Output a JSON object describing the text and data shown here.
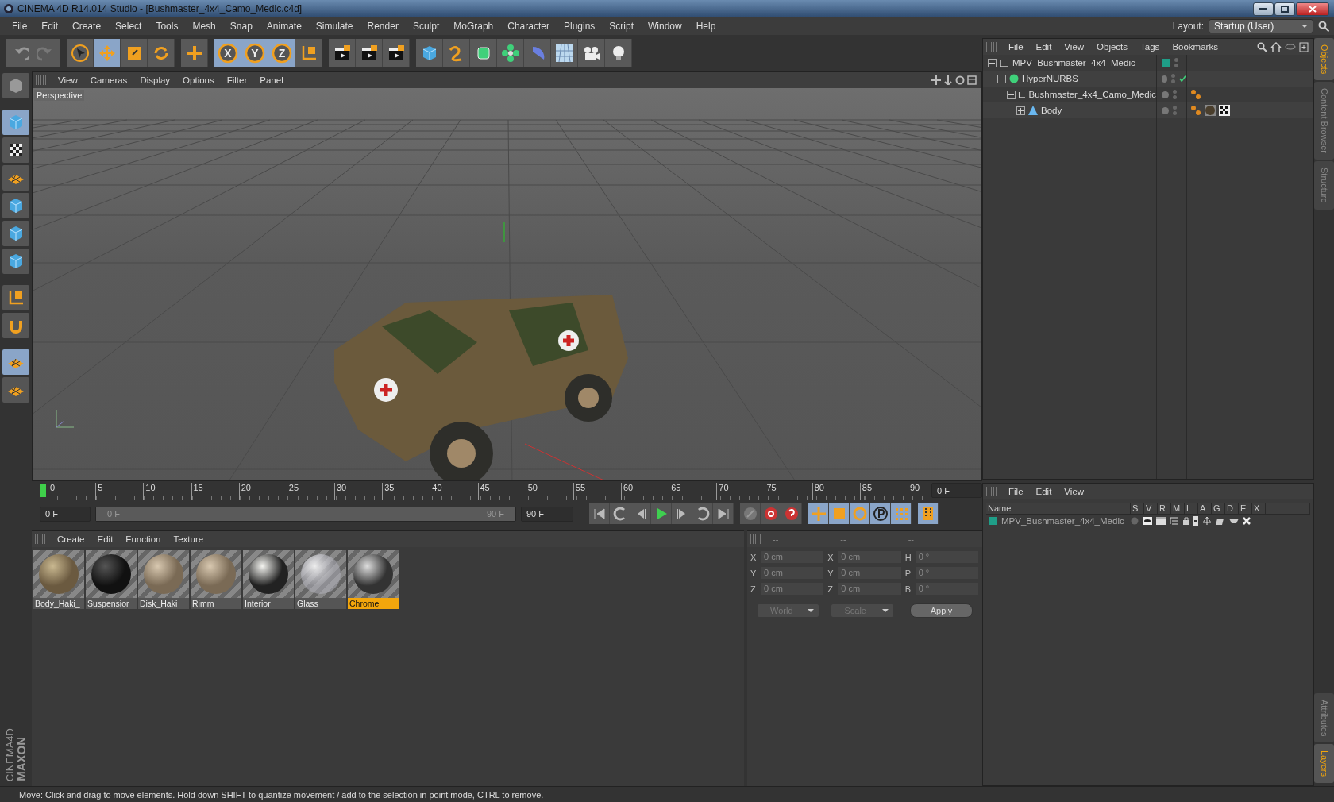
{
  "window": {
    "title": "CINEMA 4D R14.014 Studio - [Bushmaster_4x4_Camo_Medic.c4d]"
  },
  "menu": [
    "File",
    "Edit",
    "Create",
    "Select",
    "Tools",
    "Mesh",
    "Snap",
    "Animate",
    "Simulate",
    "Render",
    "Sculpt",
    "MoGraph",
    "Character",
    "Plugins",
    "Script",
    "Window",
    "Help"
  ],
  "layout": {
    "label": "Layout:",
    "value": "Startup (User)"
  },
  "toolbar": [
    [
      {
        "kind": "undo",
        "selected": false
      },
      {
        "kind": "redo",
        "selected": false
      }
    ],
    [
      {
        "kind": "select",
        "selected": false
      },
      {
        "kind": "move",
        "selected": true
      },
      {
        "kind": "scale",
        "selected": false
      },
      {
        "kind": "rotate",
        "selected": false
      }
    ],
    [
      {
        "kind": "add",
        "selected": false
      }
    ],
    [
      {
        "kind": "axis",
        "label": "X",
        "selected": true
      },
      {
        "kind": "axis",
        "label": "Y",
        "selected": true
      },
      {
        "kind": "axis",
        "label": "Z",
        "selected": true
      },
      {
        "kind": "coord",
        "selected": false
      }
    ],
    [
      {
        "kind": "render",
        "selected": false
      },
      {
        "kind": "render",
        "selected": false
      },
      {
        "kind": "render",
        "selected": false
      }
    ],
    [
      {
        "kind": "cube",
        "selected": false
      },
      {
        "kind": "spline",
        "selected": false
      },
      {
        "kind": "nurbs",
        "selected": false
      },
      {
        "kind": "array",
        "selected": false
      },
      {
        "kind": "deformer",
        "selected": false
      },
      {
        "kind": "floor",
        "selected": false
      },
      {
        "kind": "camera",
        "selected": false
      },
      {
        "kind": "light",
        "selected": false
      }
    ]
  ],
  "left_tools": [
    {
      "kind": "model",
      "selected": false
    },
    {
      "kind": "cube",
      "selected": true
    },
    {
      "kind": "checker",
      "selected": false
    },
    {
      "kind": "grid",
      "selected": false
    },
    {
      "kind": "cube",
      "selected": false
    },
    {
      "kind": "cube",
      "selected": false
    },
    {
      "kind": "cube",
      "selected": false
    },
    {
      "kind": "coord",
      "selected": false
    },
    {
      "kind": "magnet",
      "selected": false
    },
    {
      "kind": "grid",
      "selected": true
    },
    {
      "kind": "grid",
      "selected": false
    }
  ],
  "viewport": {
    "menu": [
      "View",
      "Cameras",
      "Display",
      "Options",
      "Filter",
      "Panel"
    ],
    "label": "Perspective"
  },
  "timeline": {
    "ticks": [
      "0",
      "5",
      "10",
      "15",
      "20",
      "25",
      "30",
      "35",
      "40",
      "45",
      "50",
      "55",
      "60",
      "65",
      "70",
      "75",
      "80",
      "85",
      "90"
    ],
    "current": "0 F",
    "start": "0 F",
    "range": {
      "start": "0 F",
      "end": "90 F",
      "level": 1
    },
    "end": "90 F",
    "transport": [
      [
        {
          "kind": "first",
          "selected": false
        },
        {
          "kind": "back",
          "selected": false
        },
        {
          "kind": "prev",
          "selected": false
        },
        {
          "kind": "play",
          "selected": false
        },
        {
          "kind": "next",
          "selected": false
        },
        {
          "kind": "forward",
          "selected": false
        },
        {
          "kind": "last",
          "selected": false
        }
      ],
      [
        {
          "kind": "key",
          "selected": false
        },
        {
          "kind": "record",
          "selected": false
        },
        {
          "kind": "help",
          "selected": false
        }
      ],
      [
        {
          "kind": "move",
          "selected": true
        },
        {
          "kind": "scale",
          "selected": true
        },
        {
          "kind": "rotate",
          "selected": true
        },
        {
          "kind": "param",
          "selected": true
        },
        {
          "kind": "points",
          "selected": true
        }
      ],
      [
        {
          "kind": "film",
          "selected": true
        }
      ]
    ]
  },
  "materials": {
    "menu": [
      "Create",
      "Edit",
      "Function",
      "Texture"
    ],
    "items": [
      {
        "name": "Body_Haki_",
        "kind": "rock",
        "selected": false
      },
      {
        "name": "Suspensior",
        "kind": "dark",
        "selected": false
      },
      {
        "name": "Disk_Haki",
        "kind": "sand",
        "selected": false
      },
      {
        "name": "Rimm",
        "kind": "sand",
        "selected": false
      },
      {
        "name": "Interior",
        "kind": "white",
        "selected": false
      },
      {
        "name": "Glass",
        "kind": "glass",
        "selected": false
      },
      {
        "name": "Chrome",
        "kind": "chrome",
        "selected": true
      }
    ]
  },
  "coordinates": {
    "headers": [
      "--",
      "--",
      "--"
    ],
    "rows": [
      [
        {
          "label": "X",
          "value": "0 cm"
        },
        {
          "label": "X",
          "value": "0 cm"
        },
        {
          "label": "H",
          "value": "0 °"
        }
      ],
      [
        {
          "label": "Y",
          "value": "0 cm"
        },
        {
          "label": "Y",
          "value": "0 cm"
        },
        {
          "label": "P",
          "value": "0 °"
        }
      ],
      [
        {
          "label": "Z",
          "value": "0 cm"
        },
        {
          "label": "Z",
          "value": "0 cm"
        },
        {
          "label": "B",
          "value": "0 °"
        }
      ]
    ],
    "mode": "World",
    "transform": "Scale",
    "apply": "Apply"
  },
  "objects": {
    "menu": [
      "File",
      "Edit",
      "View",
      "Objects",
      "Tags",
      "Bookmarks"
    ],
    "tree": [
      {
        "name": "MPV_Bushmaster_4x4_Medic",
        "kind": "null",
        "expanded": true,
        "color": "#1f9e88",
        "children": [
          {
            "name": "HyperNURBS",
            "kind": "nurbs",
            "expanded": true,
            "checked": true,
            "children": [
              {
                "name": "Bushmaster_4x4_Camo_Medic",
                "kind": "null",
                "expanded": true,
                "tags": [
                  {
                    "kind": "phong"
                  }
                ],
                "children": [
                  {
                    "name": "Body",
                    "kind": "poly",
                    "expanded": false,
                    "tags": [
                      {
                        "kind": "phong"
                      },
                      {
                        "kind": "material"
                      },
                      {
                        "kind": "texture"
                      }
                    ]
                  }
                ]
              }
            ]
          }
        ]
      }
    ]
  },
  "layers": {
    "menu": [
      "File",
      "Edit",
      "View"
    ],
    "columns": [
      "Name",
      "S",
      "V",
      "R",
      "M",
      "L",
      "A",
      "G",
      "D",
      "E",
      "X"
    ],
    "rows": [
      {
        "name": "MPV_Bushmaster_4x4_Medic",
        "color": "#1f9e88"
      }
    ]
  },
  "side_tabs_top": [
    {
      "label": "Objects",
      "selected": true
    },
    {
      "label": "Content Browser",
      "selected": false
    },
    {
      "label": "Structure",
      "selected": false
    }
  ],
  "side_tabs_bottom": [
    {
      "label": "Attributes",
      "selected": false
    },
    {
      "label": "Layers",
      "selected": true
    }
  ],
  "logo": [
    "MAXON",
    "CINEMA4D"
  ],
  "status_bar": "Move: Click and drag to move elements. Hold down SHIFT to quantize movement / add to the selection in point mode, CTRL to remove."
}
